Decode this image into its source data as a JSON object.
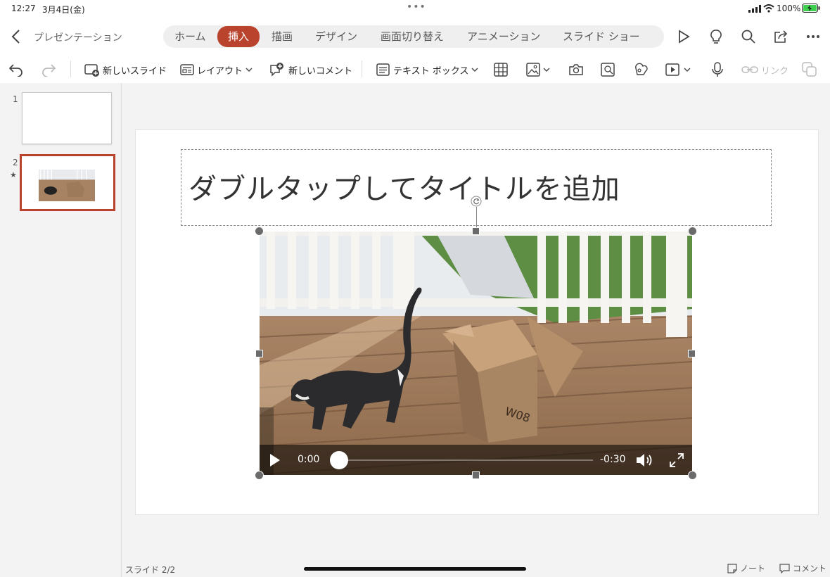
{
  "status": {
    "time": "12:27",
    "date": "3月4日(金)",
    "battery": "100%"
  },
  "header": {
    "doc_title": "プレゼンテーション",
    "tabs": [
      "ホーム",
      "挿入",
      "描画",
      "デザイン",
      "画面切り替え",
      "アニメーション",
      "スライド ショー"
    ]
  },
  "ribbon": {
    "new_slide": "新しいスライド",
    "layout": "レイアウト",
    "new_comment": "新しいコメント",
    "text_box": "テキスト ボックス",
    "link": "リンク"
  },
  "thumbnails": [
    {
      "number": "1"
    },
    {
      "number": "2",
      "marker": "★"
    }
  ],
  "slide": {
    "title_placeholder": "ダブルタップしてタイトルを追加"
  },
  "video": {
    "current_time": "0:00",
    "remaining_time": "-0:30",
    "box_label": "W08",
    "progress": 0
  },
  "footer": {
    "slide_counter": "スライド 2/2",
    "notes": "ノート",
    "comments": "コメント"
  },
  "colors": {
    "accent": "#b9432d"
  }
}
